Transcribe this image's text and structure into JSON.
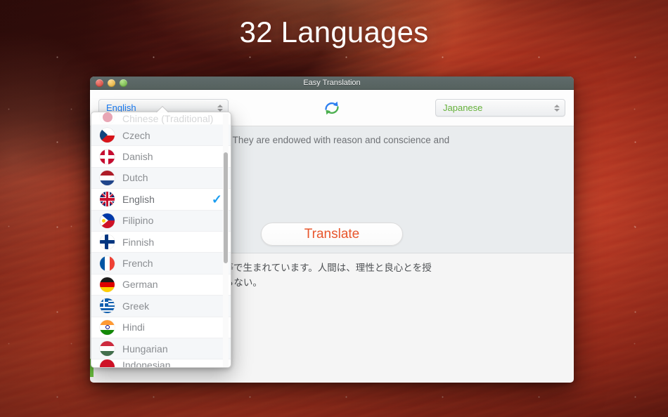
{
  "desktop": {
    "headline": "32 Languages",
    "wallpaper_colors": [
      "#6e1a12",
      "#b03d26",
      "#3d100d",
      "#d8643a"
    ]
  },
  "window": {
    "title": "Easy Translation",
    "traffic_lights": [
      {
        "name": "close",
        "color": "#c9362c"
      },
      {
        "name": "minimize",
        "color": "#d9a329"
      },
      {
        "name": "zoom",
        "color": "#5ea437"
      }
    ],
    "accent_color": "#6abf3f"
  },
  "toolbar": {
    "source_language": "English",
    "source_language_color": "#1b7ef7",
    "target_language": "Japanese",
    "target_language_color": "#65b13a",
    "swap_icon": "swap-languages-icon",
    "swap_icon_colors": [
      "#2d7ff0",
      "#4caf50"
    ]
  },
  "source_panel": {
    "text": "and equal in dignity and rights. They are endowed with reason and conscience and\n in a spirit of brotherhood.'"
  },
  "translate_button": {
    "label": "Translate",
    "color": "#e8562c"
  },
  "output_panel": {
    "text": "つ、尊厳と権利とについて平等で生まれています。人間は、理性と良心とを授\n神をもって行動しなければならない。"
  },
  "dropdown": {
    "open": true,
    "selected": "English",
    "check_color": "#1b9df0",
    "items": [
      {
        "label": "Chinese (Traditional)",
        "flag": "jp",
        "selected": false,
        "clipped": "top"
      },
      {
        "label": "Czech",
        "flag": "cz",
        "selected": false
      },
      {
        "label": "Danish",
        "flag": "dk",
        "selected": false
      },
      {
        "label": "Dutch",
        "flag": "nl",
        "selected": false
      },
      {
        "label": "English",
        "flag": "gb",
        "selected": true
      },
      {
        "label": "Filipino",
        "flag": "ph",
        "selected": false
      },
      {
        "label": "Finnish",
        "flag": "fi",
        "selected": false
      },
      {
        "label": "French",
        "flag": "fr",
        "selected": false
      },
      {
        "label": "German",
        "flag": "de",
        "selected": false
      },
      {
        "label": "Greek",
        "flag": "gr",
        "selected": false
      },
      {
        "label": "Hindi",
        "flag": "in",
        "selected": false
      },
      {
        "label": "Hungarian",
        "flag": "hu",
        "selected": false
      },
      {
        "label": "Indonesian",
        "flag": "id",
        "selected": false,
        "clipped": "bottom"
      }
    ]
  }
}
